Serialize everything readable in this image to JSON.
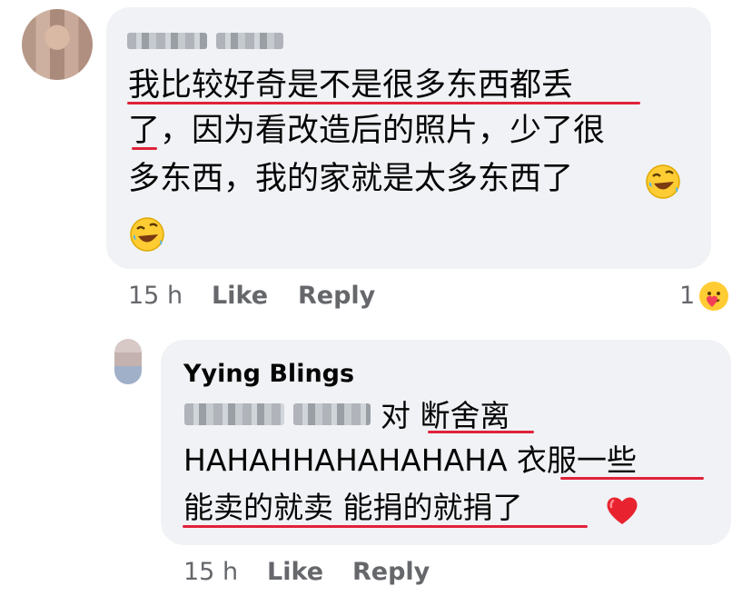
{
  "comment": {
    "lines": [
      "我比较好奇是不是很多东西都丢",
      "了，因为看改造后的照片，少了很",
      "多东西，我的家就是太多东西了"
    ],
    "emoji_icons": [
      "rolling-on-floor-laughing-icon",
      "rolling-on-floor-laughing-icon"
    ],
    "time": "15 h",
    "like_label": "Like",
    "reply_label": "Reply",
    "reaction_count": "1",
    "reaction_icon": "care-reaction-icon"
  },
  "reply": {
    "author": "Yying Blings",
    "lines": [
      "对 断舍离",
      "HAHAHHAHAHAHAHA 衣服一些",
      "能卖的就卖 能捐的就捐了"
    ],
    "emoji_icon": "red-heart-icon",
    "time": "15 h",
    "like_label": "Like",
    "reply_label": "Reply"
  },
  "colors": {
    "bubble": "#f0f2f5",
    "text": "#050505",
    "meta": "#65676b",
    "underline": "#e0223a"
  }
}
